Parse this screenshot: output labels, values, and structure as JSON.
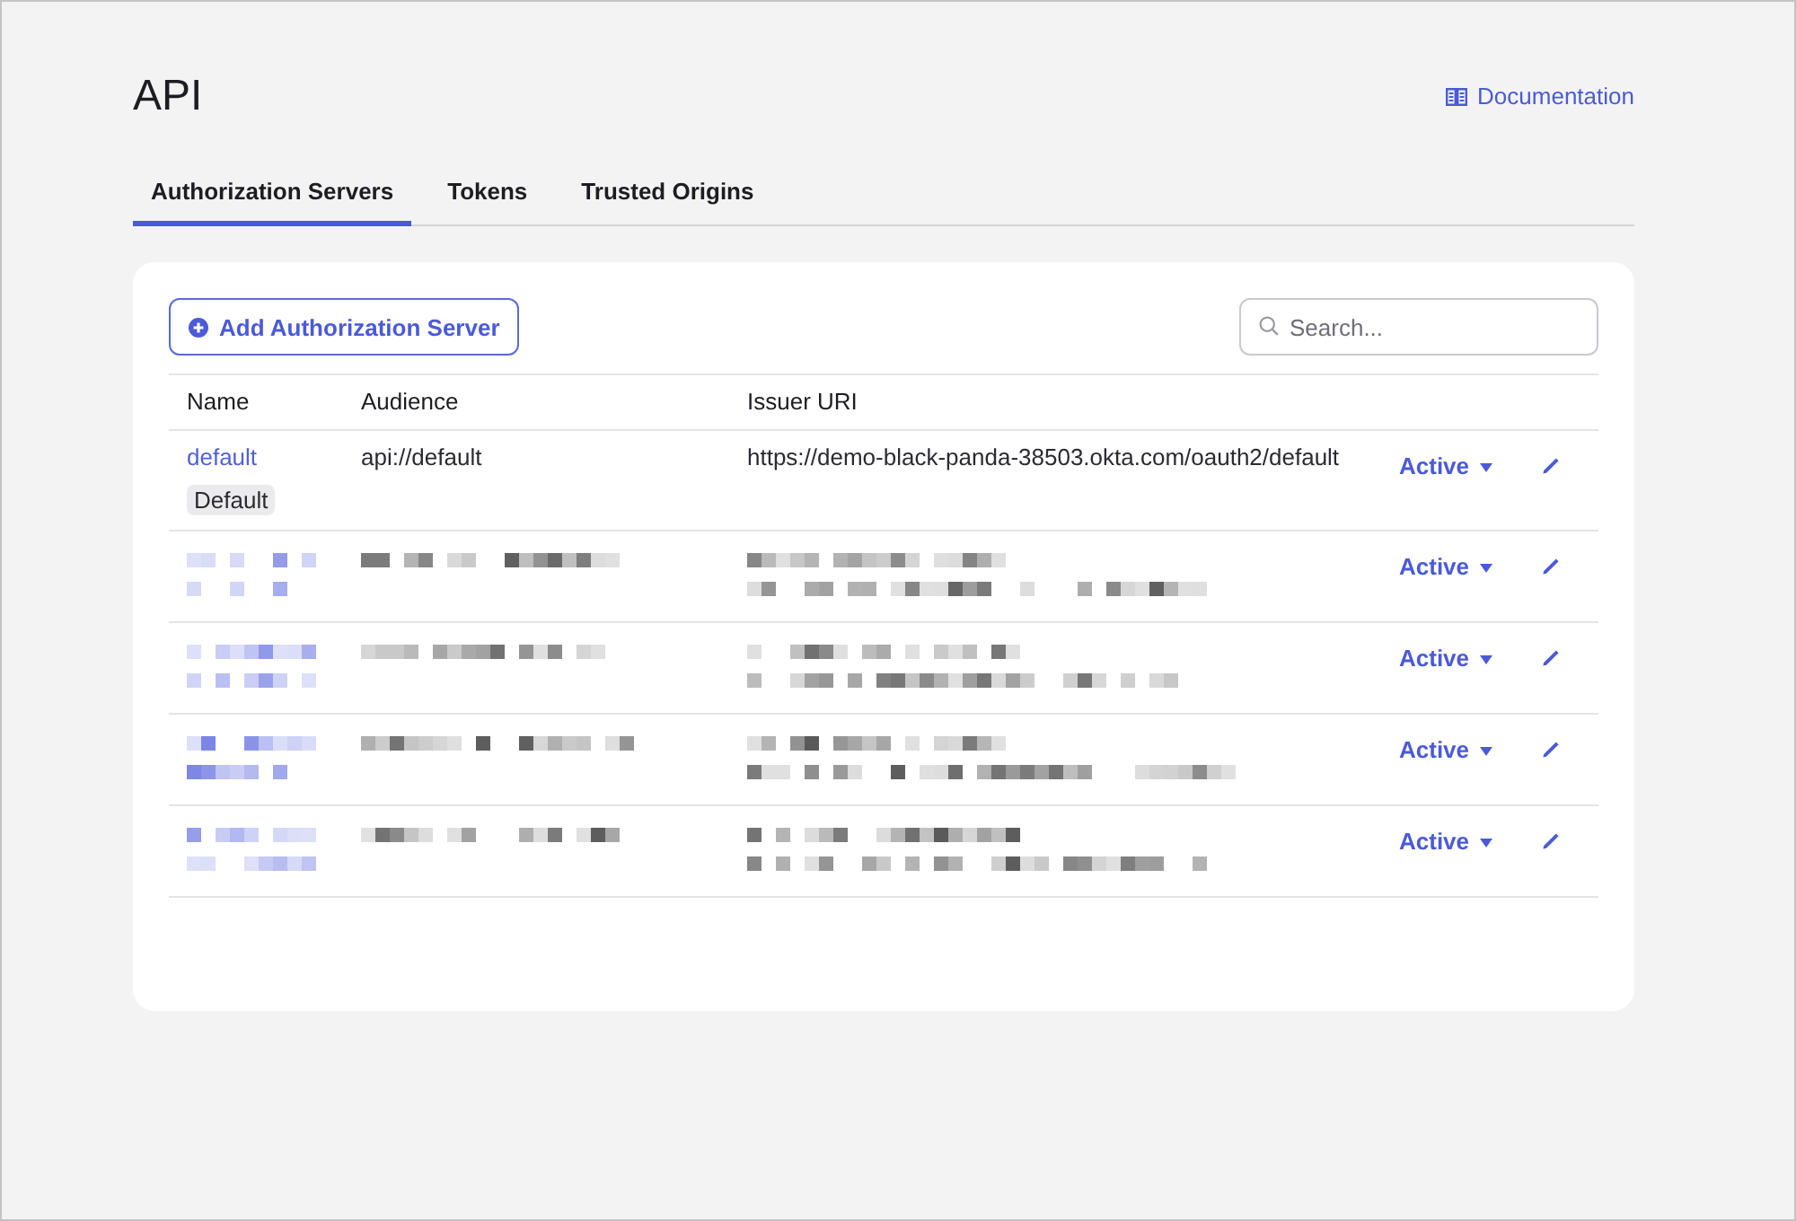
{
  "header": {
    "title": "API",
    "documentation_link": "Documentation"
  },
  "tabs": [
    {
      "label": "Authorization Servers",
      "selected": true
    },
    {
      "label": "Tokens",
      "selected": false
    },
    {
      "label": "Trusted Origins",
      "selected": false
    }
  ],
  "toolbar": {
    "add_button": "Add Authorization Server",
    "search": {
      "placeholder": "Search..."
    }
  },
  "table": {
    "columns": [
      "Name",
      "Audience",
      "Issuer URI"
    ],
    "rows": [
      {
        "kind": "plain",
        "name": "default",
        "badge": "Default",
        "audience": "api://default",
        "issuer_uri": "https://demo-black-panda-38503.okta.com/oauth2/default",
        "status": "Active"
      },
      {
        "kind": "pixelated",
        "status": "Active"
      },
      {
        "kind": "pixelated",
        "status": "Active"
      },
      {
        "kind": "pixelated",
        "status": "Active"
      },
      {
        "kind": "pixelated",
        "status": "Active"
      }
    ]
  }
}
